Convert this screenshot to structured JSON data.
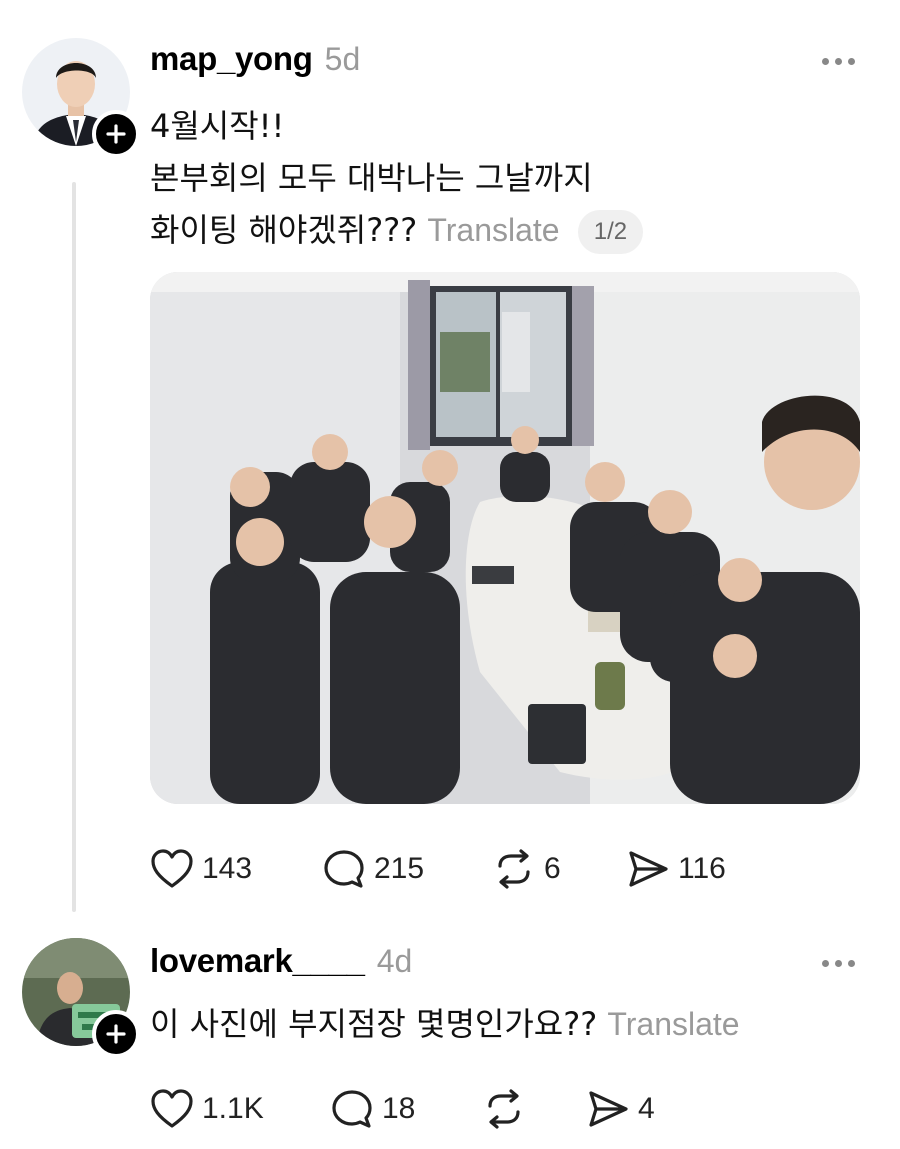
{
  "post": {
    "username": "map_yong",
    "time": "5d",
    "text_lines": [
      "4월시작!!",
      "본부회의 모두 대박나는 그날까지",
      "화이팅 해야겠쥐???"
    ],
    "translate_label": "Translate",
    "pager": "1/2",
    "actions": {
      "likes": "143",
      "replies": "215",
      "reposts": "6",
      "shares": "116"
    },
    "icons": [
      "heart-icon",
      "comment-icon",
      "repost-icon",
      "share-icon",
      "more-icon",
      "follow-plus-icon"
    ]
  },
  "reply": {
    "username": "lovemark____",
    "time": "4d",
    "text": "이 사진에 부지점장 몇명인가요??",
    "translate_label": "Translate",
    "actions": {
      "likes": "1.1K",
      "replies": "18",
      "reposts": "",
      "shares": "4"
    }
  },
  "colors": {
    "muted": "#9a9a9a",
    "thread_line": "#e3e3e3",
    "text": "#111111"
  }
}
